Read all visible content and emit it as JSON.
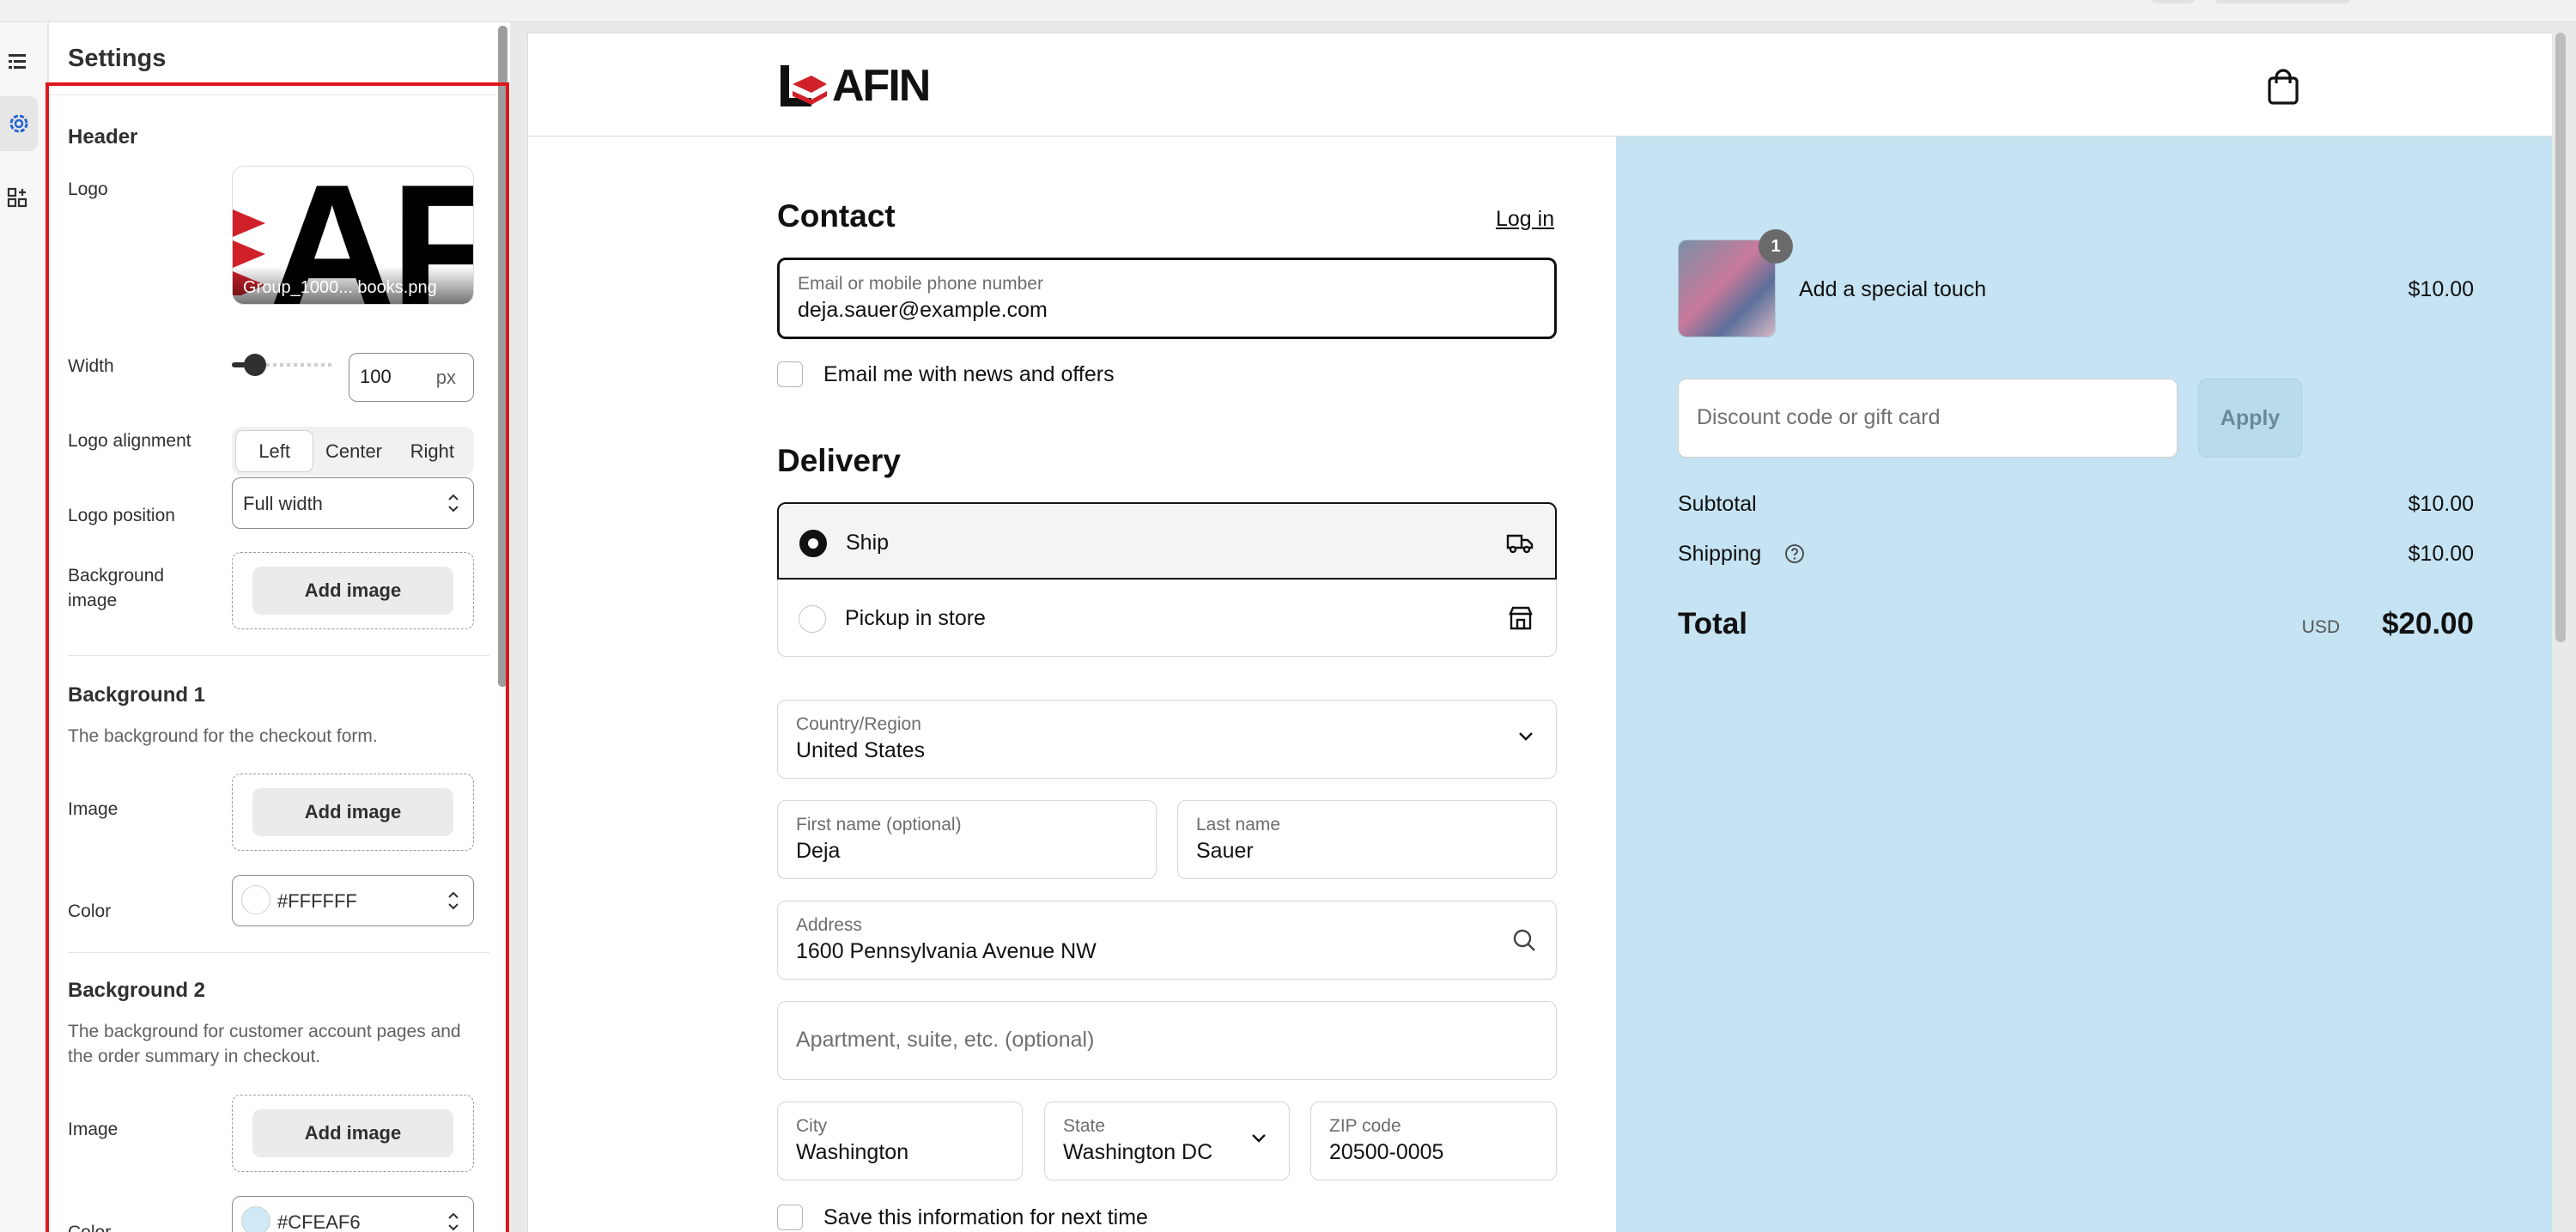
{
  "settings": {
    "title": "Settings",
    "header": {
      "section_title": "Header",
      "logo_label": "Logo",
      "logo_mark": "AF",
      "logo_filename": "Group_1000... books.png",
      "width_label": "Width",
      "width_value": "100",
      "width_unit": "px",
      "width_slider_fraction": 0.12,
      "alignment_label": "Logo alignment",
      "alignment_options": [
        "Left",
        "Center",
        "Right"
      ],
      "alignment_selected": "Left",
      "position_label": "Logo position",
      "position_value": "Full width",
      "bg_image_label": "Background image",
      "add_image": "Add image"
    },
    "background1": {
      "section_title": "Background 1",
      "description": "The background for the checkout form.",
      "image_label": "Image",
      "add_image": "Add image",
      "color_label": "Color",
      "color_value": "#FFFFFF"
    },
    "background2": {
      "section_title": "Background 2",
      "description": "The background for customer account pages and the order summary in checkout.",
      "image_label": "Image",
      "add_image": "Add image",
      "color_label": "Color",
      "color_value": "#CFEAF6"
    }
  },
  "checkout": {
    "brand_name": "LEAFIN",
    "brand_word": "AFIN",
    "contact": {
      "heading": "Contact",
      "login_link": "Log in",
      "email_label": "Email or mobile phone number",
      "email_value": "deja.sauer@example.com",
      "news_label": "Email me with news and offers"
    },
    "delivery": {
      "heading": "Delivery",
      "ship_label": "Ship",
      "pickup_label": "Pickup in store",
      "selected": "Ship",
      "country_label": "Country/Region",
      "country_value": "United States",
      "first_name_label": "First name (optional)",
      "first_name_value": "Deja",
      "last_name_label": "Last name",
      "last_name_value": "Sauer",
      "address_label": "Address",
      "address_value": "1600 Pennsylvania Avenue NW",
      "apartment_placeholder": "Apartment, suite, etc. (optional)",
      "city_label": "City",
      "city_value": "Washington",
      "state_label": "State",
      "state_value": "Washington DC",
      "zip_label": "ZIP code",
      "zip_value": "20500-0005",
      "save_info_label": "Save this information for next time"
    },
    "summary": {
      "item_name": "Add a special touch",
      "item_price": "$10.00",
      "item_qty": "1",
      "discount_placeholder": "Discount code or gift card",
      "apply_label": "Apply",
      "subtotal_label": "Subtotal",
      "subtotal_value": "$10.00",
      "shipping_label": "Shipping",
      "shipping_value": "$10.00",
      "total_label": "Total",
      "currency": "USD",
      "total_value": "$20.00",
      "background_color": "#CFEAF6"
    }
  },
  "colors": {
    "highlight": "#e0161c",
    "accent_dark": "#111111"
  }
}
